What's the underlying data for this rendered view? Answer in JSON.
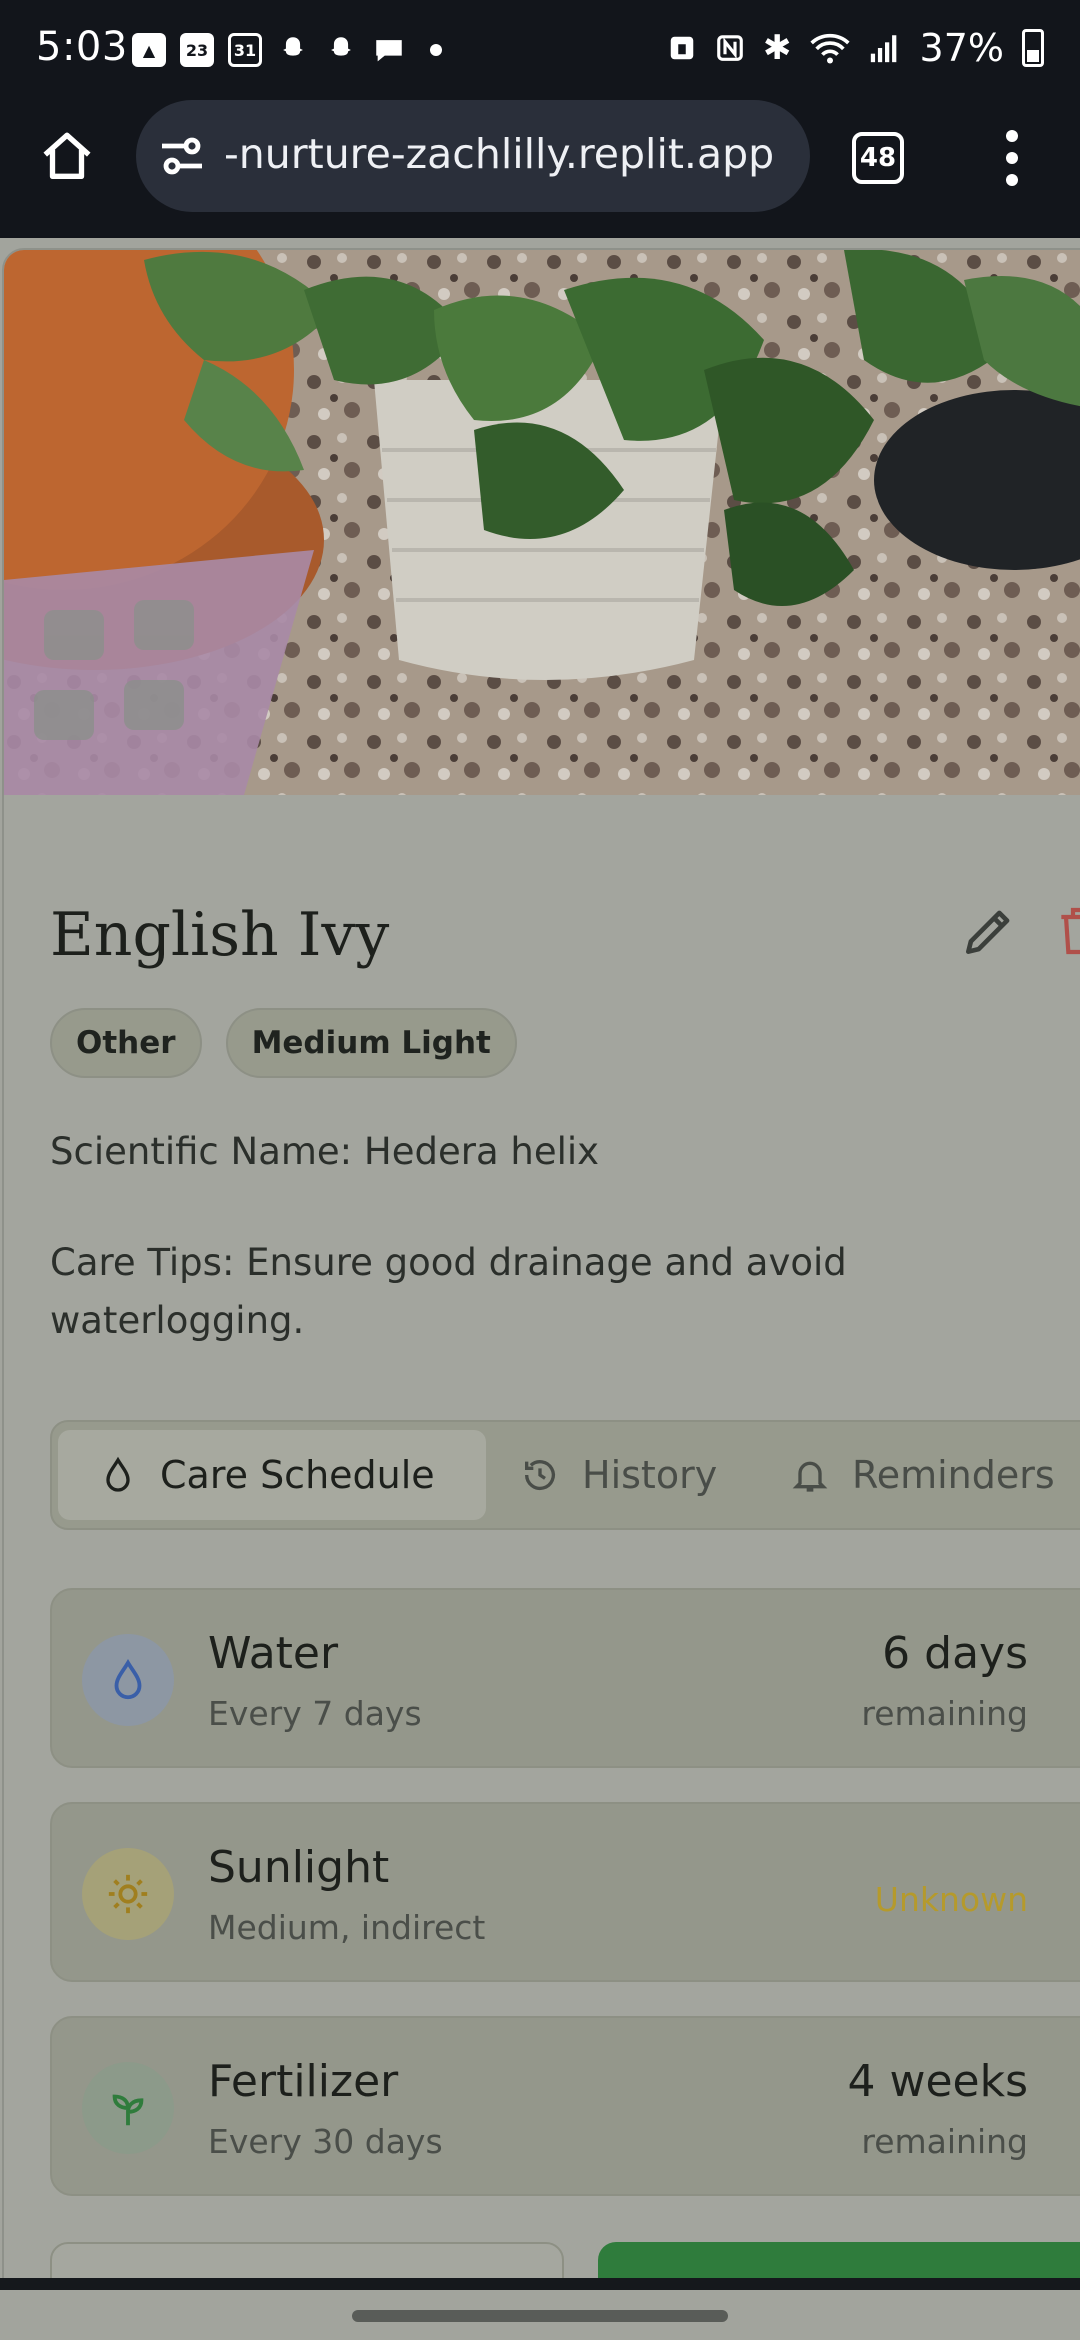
{
  "status_bar": {
    "time": "5:03",
    "notif_icons": [
      "gallery-icon",
      "calendar-23-icon",
      "calendar-31-icon",
      "snapchat-icon",
      "snapchat-icon",
      "chat-icon"
    ],
    "cal_a": "23",
    "cal_b": "31",
    "battery": "37%",
    "sys_icons": [
      "nfc-icon",
      "bluetooth-icon",
      "wifi-icon",
      "signal-icon",
      "battery-icon"
    ]
  },
  "browser": {
    "url": "-nurture-zachlilly.replit.app",
    "tab_count": "48"
  },
  "plant": {
    "name": "English Ivy",
    "badges": [
      "Other",
      "Medium Light"
    ],
    "scientific": "Scientific Name: Hedera helix",
    "care_tips": "Care Tips: Ensure good drainage and avoid waterlogging."
  },
  "tabs": [
    {
      "label": "Care Schedule",
      "icon": "droplet-icon",
      "active": true
    },
    {
      "label": "History",
      "icon": "history-icon",
      "active": false
    },
    {
      "label": "Reminders",
      "icon": "bell-icon",
      "active": false
    }
  ],
  "care": [
    {
      "title": "Water",
      "sub": "Every 7 days",
      "value": "6 days",
      "unit": "remaining",
      "icon": "droplet-icon",
      "icon_bg": "#8d97a3",
      "icon_color": "#3a5fa8"
    },
    {
      "title": "Sunlight",
      "sub": "Medium, indirect",
      "status": "Unknown",
      "icon": "sun-icon",
      "icon_bg": "#a5a178",
      "icon_color": "#a07f1f"
    },
    {
      "title": "Fertilizer",
      "sub": "Every 30 days",
      "value": "4 weeks",
      "unit": "remaining",
      "icon": "sprout-icon",
      "icon_bg": "#8c9a8a",
      "icon_color": "#2f7c3c"
    }
  ],
  "colors": {
    "overlay": "#a2a49d",
    "accent_green": "#2f7c3c",
    "status_unknown": "#b59a2c"
  }
}
